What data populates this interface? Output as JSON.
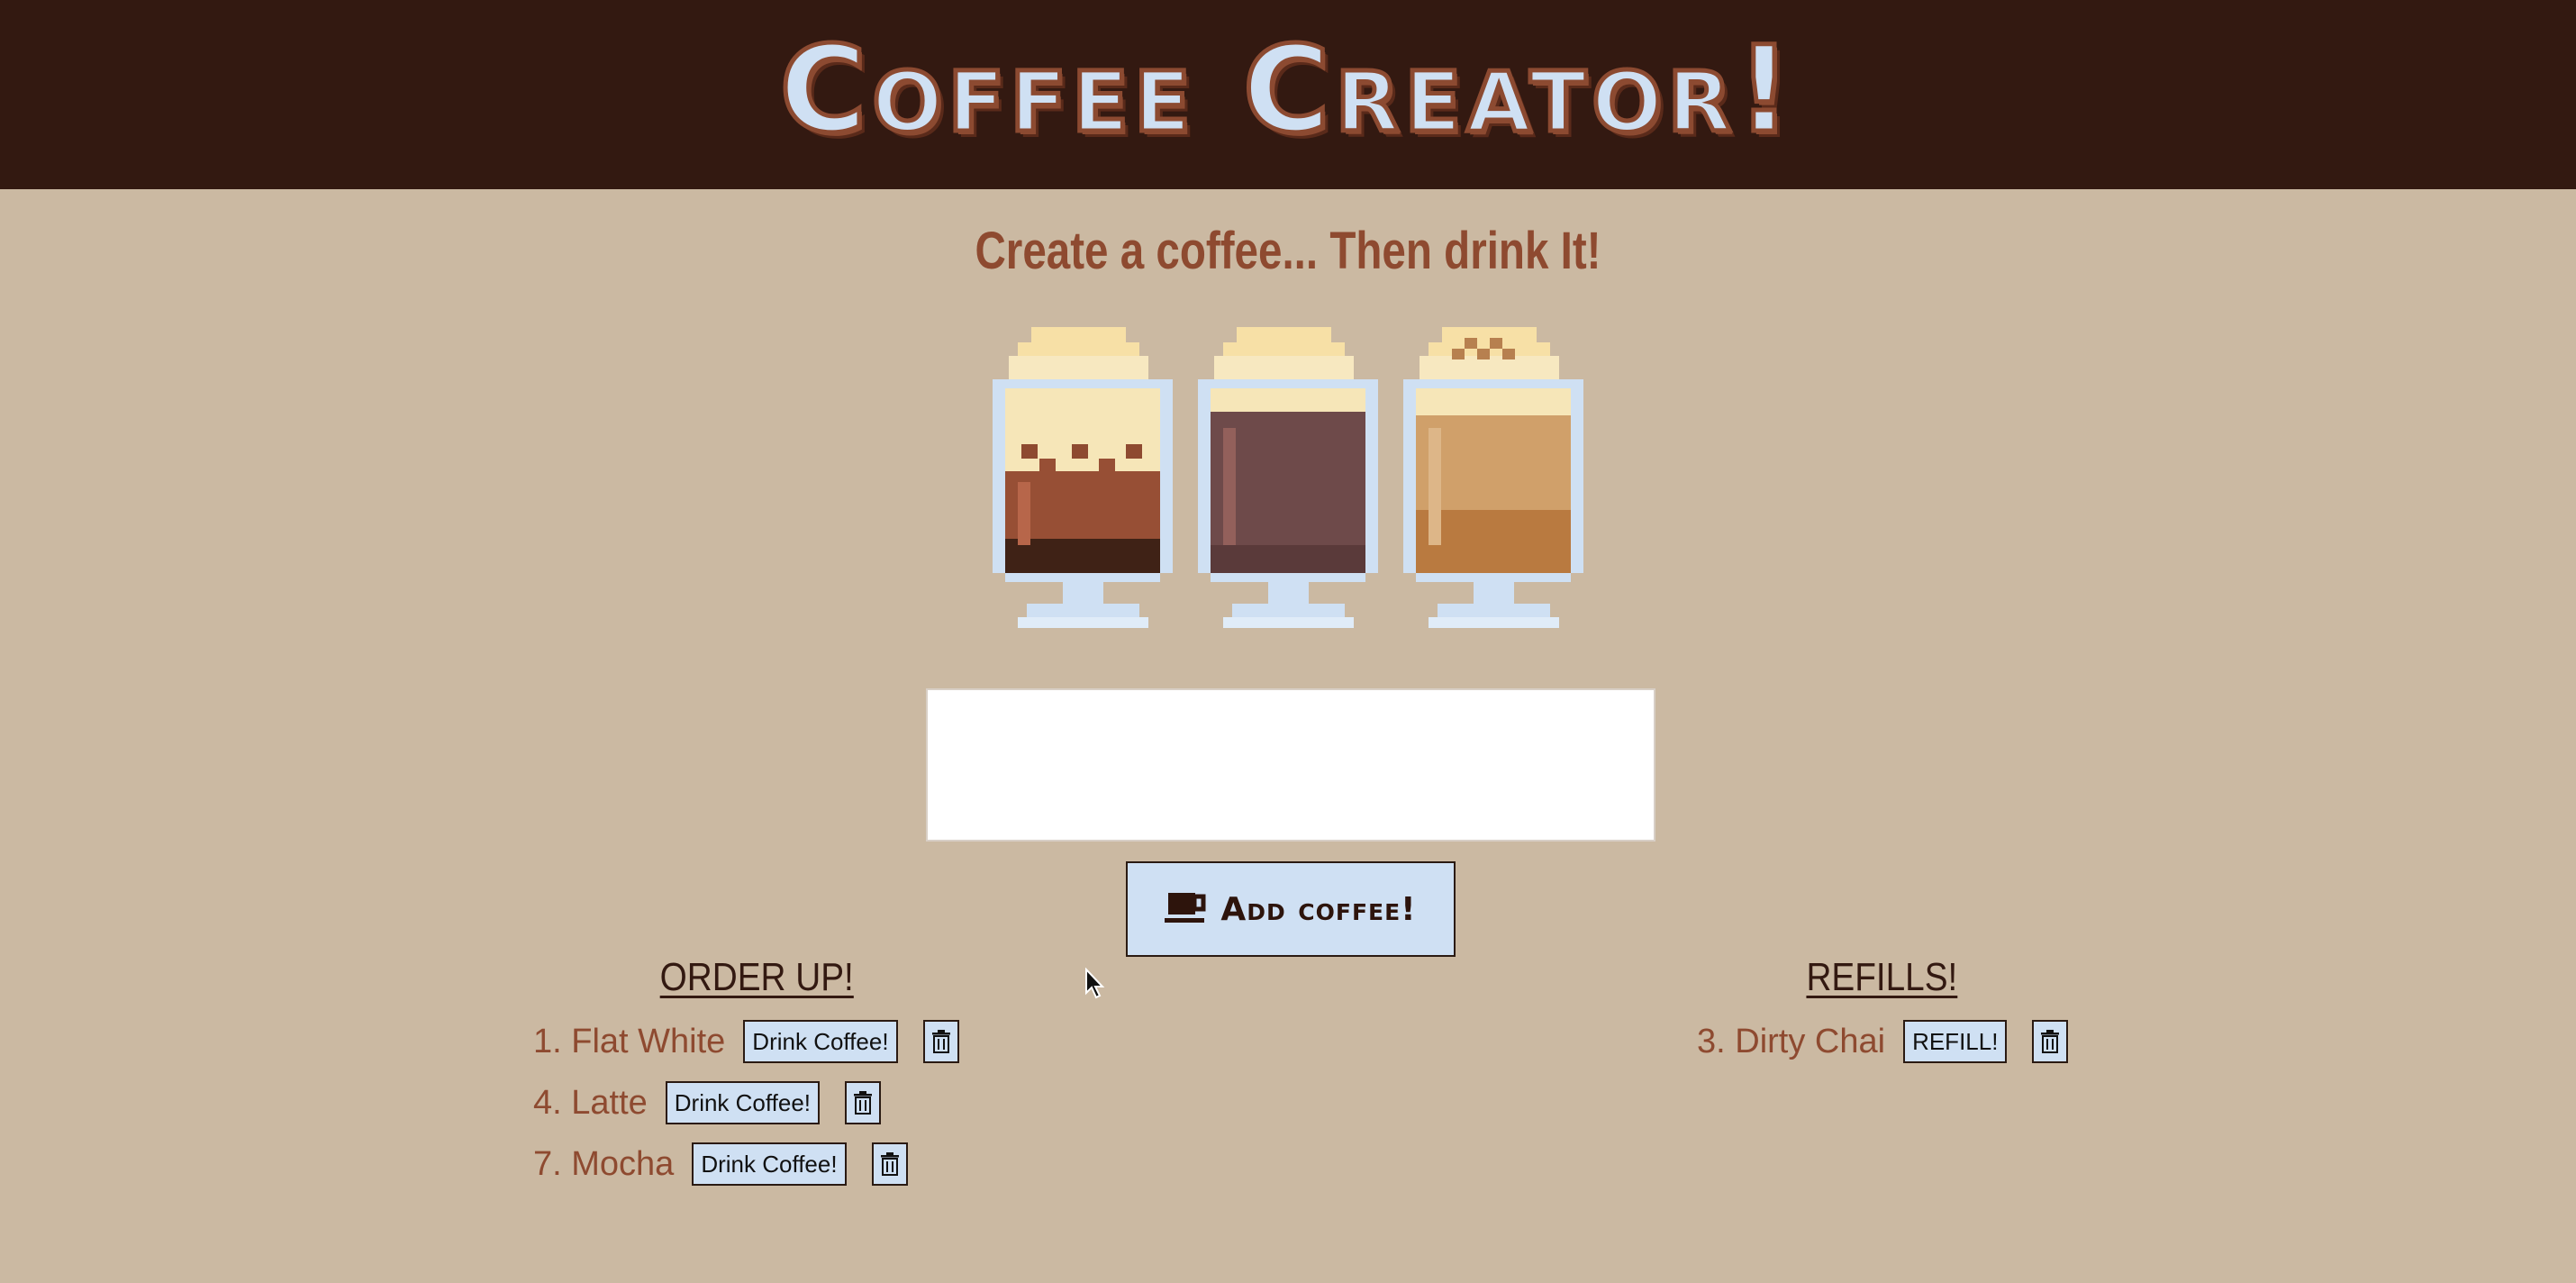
{
  "header": {
    "title": "Coffee Creator!",
    "background_color": "#331911"
  },
  "main": {
    "tagline": "Create a coffee... Then drink It!",
    "coffee_input": {
      "value": "",
      "placeholder": ""
    },
    "add_button": {
      "label": "Add coffee!",
      "icon": "coffee-cup-icon"
    }
  },
  "order_up": {
    "heading": "ORDER UP!",
    "items": [
      {
        "label": "1. Flat White",
        "action_label": "Drink Coffee!"
      },
      {
        "label": "4. Latte",
        "action_label": "Drink Coffee!"
      },
      {
        "label": "7. Mocha",
        "action_label": "Drink Coffee!"
      }
    ]
  },
  "refills": {
    "heading": "REFILLS!",
    "items": [
      {
        "label": "3. Dirty Chai",
        "action_label": "REFILL!"
      }
    ]
  },
  "colors": {
    "page_background": "#cbb9a2",
    "accent_text": "#8e4a30",
    "button_background": "#cfe0f3"
  }
}
